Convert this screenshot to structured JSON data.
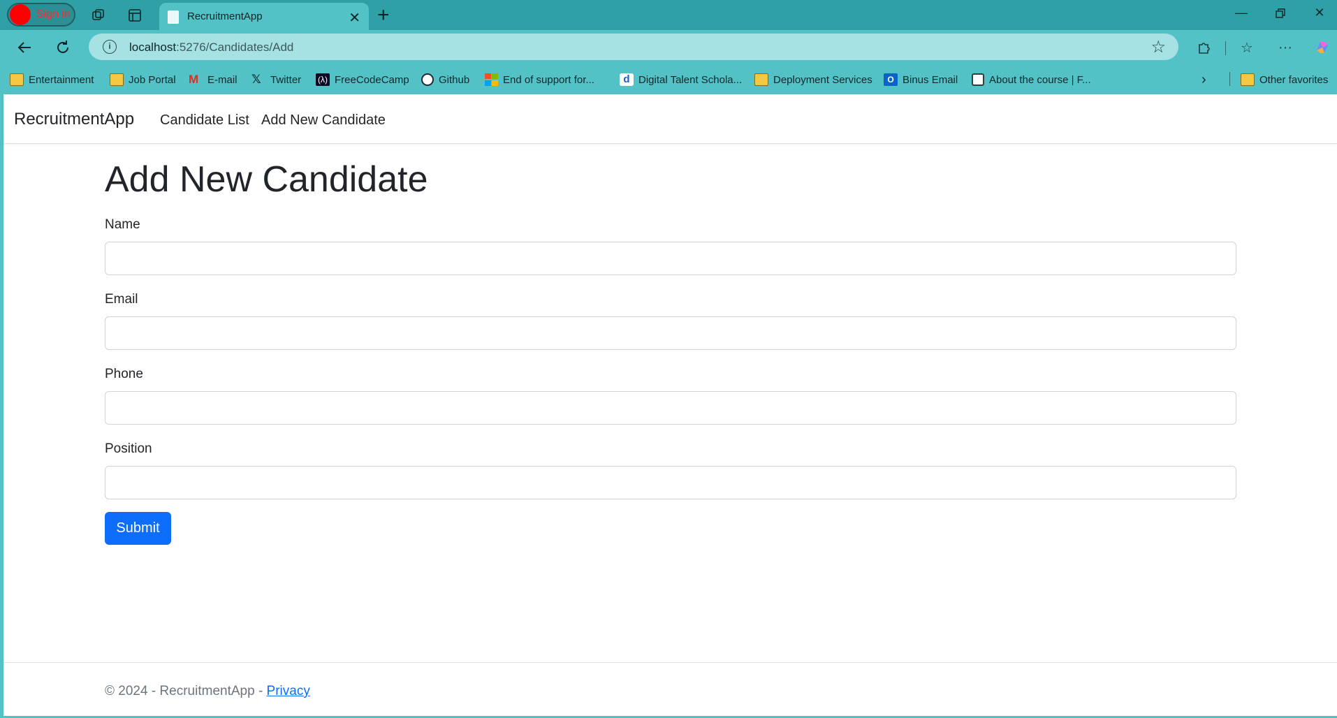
{
  "browser": {
    "signin_label": "Sign in",
    "tab_title": "RecruitmentApp",
    "url_host": "localhost",
    "url_rest": ":5276/Candidates/Add",
    "bookmarks": [
      {
        "label": "Entertainment",
        "icon": "folder-icon"
      },
      {
        "label": "Job Portal",
        "icon": "folder-icon"
      },
      {
        "label": "E-mail",
        "icon": "gmail-icon"
      },
      {
        "label": "Twitter",
        "icon": "x-icon"
      },
      {
        "label": "FreeCodeCamp",
        "icon": "freecodecamp-icon"
      },
      {
        "label": "Github",
        "icon": "github-icon"
      },
      {
        "label": "End of support for...",
        "icon": "microsoft-icon"
      },
      {
        "label": "Digital Talent Schola...",
        "icon": "dts-icon"
      },
      {
        "label": "Deployment Services",
        "icon": "folder-icon"
      },
      {
        "label": "Binus Email",
        "icon": "outlook-icon"
      },
      {
        "label": "About the course | F...",
        "icon": "course-icon"
      }
    ],
    "other_favorites": "Other favorites"
  },
  "navbar": {
    "brand": "RecruitmentApp",
    "links": [
      "Candidate List",
      "Add New Candidate"
    ]
  },
  "form": {
    "heading": "Add New Candidate",
    "fields": [
      {
        "label": "Name",
        "value": ""
      },
      {
        "label": "Email",
        "value": ""
      },
      {
        "label": "Phone",
        "value": ""
      },
      {
        "label": "Position",
        "value": ""
      }
    ],
    "submit_label": "Submit"
  },
  "footer": {
    "text": "© 2024 - RecruitmentApp - ",
    "privacy_link": "Privacy"
  },
  "colors": {
    "browser_frame": "#53c2c6",
    "tabbar": "#2fa0a6",
    "primary_button": "#0d6efd"
  }
}
